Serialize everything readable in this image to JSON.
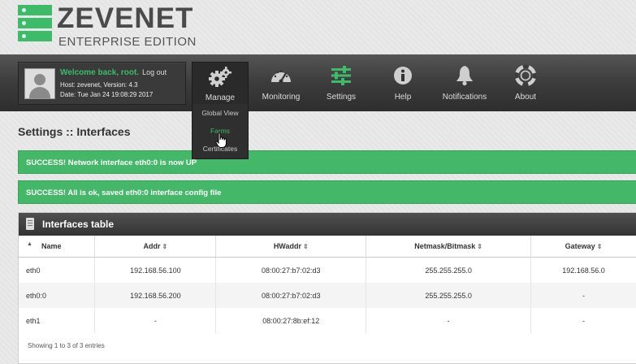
{
  "brand": {
    "name": "ZEVENET",
    "edition": "ENTERPRISE EDITION",
    "accent": "#3dbb6a"
  },
  "user": {
    "welcome": "Welcome back, root.",
    "logout": "Log out",
    "host": "Host: zevenet, Version: 4.3",
    "date": "Date: Tue Jan 24 19:08:29 2017"
  },
  "nav": {
    "manage": "Manage",
    "monitoring": "Monitoring",
    "settings": "Settings",
    "help": "Help",
    "notifications": "Notifications",
    "about": "About"
  },
  "dropdown": {
    "items": [
      "Global View",
      "Farms",
      "Certificates"
    ],
    "hovered": "Farms"
  },
  "page_title": "Settings :: Interfaces",
  "alerts": [
    "SUCCESS! Network interface eth0:0 is now UP",
    "SUCCESS! All is ok, saved eth0:0 interface config file"
  ],
  "table": {
    "title": "Interfaces table",
    "columns": [
      "Name",
      "Addr",
      "HWaddr",
      "Netmask/Bitmask",
      "Gateway"
    ],
    "rows": [
      [
        "eth0",
        "192.168.56.100",
        "08:00:27:b7:02:d3",
        "255.255.255.0",
        "192.168.56.0"
      ],
      [
        "eth0:0",
        "192.168.56.200",
        "08:00:27:b7:02:d3",
        "255.255.255.0",
        "-"
      ],
      [
        "eth1",
        "-",
        "08:00:27:8b:ef:12",
        "-",
        "-"
      ]
    ],
    "footer": "Showing 1 to 3 of 3 entries"
  }
}
